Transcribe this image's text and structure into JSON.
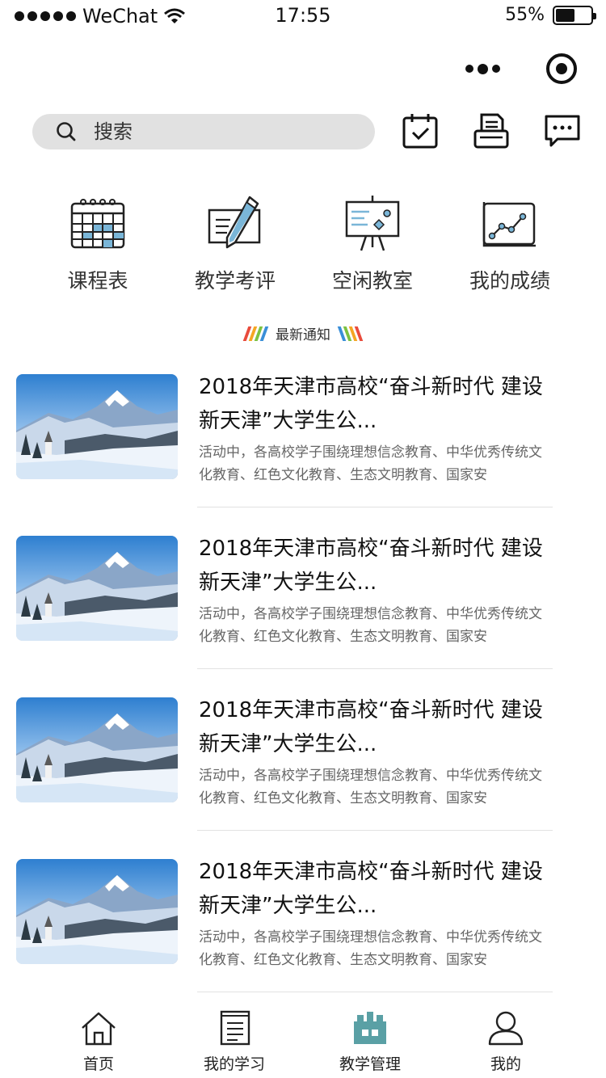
{
  "status_bar": {
    "carrier": "WeChat",
    "time": "17:55",
    "battery": "55%",
    "battery_level": 0.55
  },
  "search": {
    "placeholder": "搜索"
  },
  "quick_menu": [
    {
      "label": "课程表",
      "icon": "calendar-grid-icon"
    },
    {
      "label": "教学考评",
      "icon": "edit-document-icon"
    },
    {
      "label": "空闲教室",
      "icon": "presentation-board-icon"
    },
    {
      "label": "我的成绩",
      "icon": "line-chart-icon"
    }
  ],
  "section": {
    "title": "最新通知",
    "stripe_colors": [
      "#e94b3c",
      "#f5a623",
      "#7cc242",
      "#3a8fd8"
    ]
  },
  "news": [
    {
      "title": "2018年天津市高校“奋斗新时代 建设新天津”大学生公...",
      "summary": "活动中，各高校学子围绕理想信念教育、中华优秀传统文化教育、红色文化教育、生态文明教育、国家安"
    },
    {
      "title": "2018年天津市高校“奋斗新时代 建设新天津”大学生公...",
      "summary": "活动中，各高校学子围绕理想信念教育、中华优秀传统文化教育、红色文化教育、生态文明教育、国家安"
    },
    {
      "title": "2018年天津市高校“奋斗新时代 建设新天津”大学生公...",
      "summary": "活动中，各高校学子围绕理想信念教育、中华优秀传统文化教育、红色文化教育、生态文明教育、国家安"
    },
    {
      "title": "2018年天津市高校“奋斗新时代 建设新天津”大学生公...",
      "summary": "活动中，各高校学子围绕理想信念教育、中华优秀传统文化教育、红色文化教育、生态文明教育、国家安"
    }
  ],
  "tab_bar": [
    {
      "label": "首页",
      "icon": "home-icon"
    },
    {
      "label": "我的学习",
      "icon": "notebook-icon"
    },
    {
      "label": "教学管理",
      "icon": "building-icon",
      "active": true
    },
    {
      "label": "我的",
      "icon": "user-icon"
    }
  ],
  "colors": {
    "accent": "#5aa0a5",
    "search_bg": "#e1e1e1",
    "text_primary": "#111111",
    "text_secondary": "#666666"
  }
}
